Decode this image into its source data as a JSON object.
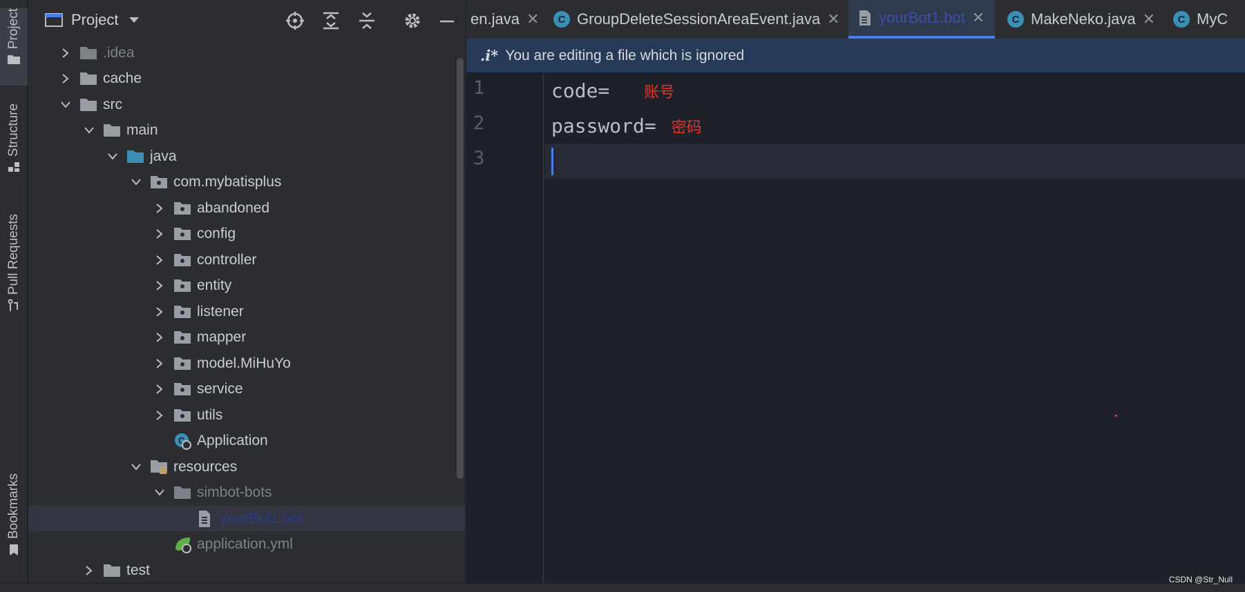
{
  "tool_strip": {
    "project_label": "Project",
    "structure_label": "Structure",
    "pull_requests_label": "Pull Requests",
    "bookmarks_label": "Bookmarks"
  },
  "project_panel": {
    "title": "Project",
    "tree": [
      {
        "label": ".idea",
        "dim": true
      },
      {
        "label": "cache"
      },
      {
        "label": "src"
      },
      {
        "label": "main"
      },
      {
        "label": "java"
      },
      {
        "label": "com.mybatisplus"
      },
      {
        "label": "abandoned"
      },
      {
        "label": "config"
      },
      {
        "label": "controller"
      },
      {
        "label": "entity"
      },
      {
        "label": "listener"
      },
      {
        "label": "mapper"
      },
      {
        "label": "model.MiHuYo"
      },
      {
        "label": "service"
      },
      {
        "label": "utils"
      },
      {
        "label": "Application"
      },
      {
        "label": "resources"
      },
      {
        "label": "simbot-bots",
        "dim": true
      },
      {
        "label": "yourBot1.bot",
        "selected": true
      },
      {
        "label": "application.yml",
        "dim": true
      },
      {
        "label": "test"
      }
    ]
  },
  "tabs": [
    {
      "label": "en.java",
      "icon": ""
    },
    {
      "label": "GroupDeleteSessionAreaEvent.java",
      "icon": "C"
    },
    {
      "label": "yourBot1.bot",
      "icon": "file",
      "active": true
    },
    {
      "label": "MakeNeko.java",
      "icon": "C"
    },
    {
      "label": "MyC",
      "icon": "C"
    }
  ],
  "banner": {
    "mark": ".i*",
    "text": "You are editing a file which is ignored"
  },
  "editor": {
    "lines": [
      {
        "num": "1",
        "code": "code=",
        "note": "账号"
      },
      {
        "num": "2",
        "code": "password=",
        "note": "密码"
      },
      {
        "num": "3",
        "code": "",
        "note": ""
      }
    ]
  },
  "watermark": "CSDN @Str_Null",
  "colors": {
    "accent": "#4a7ee8",
    "annotation_red": "#e5322b",
    "banner_bg": "#263a57"
  }
}
